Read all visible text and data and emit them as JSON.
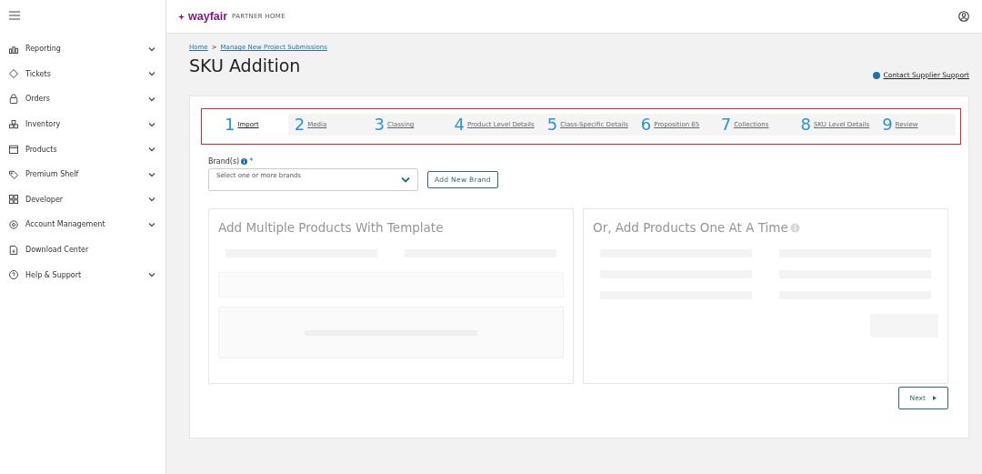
{
  "sidebar": {
    "items": [
      {
        "label": "Reporting",
        "has_submenu": true
      },
      {
        "label": "Tickets",
        "has_submenu": true
      },
      {
        "label": "Orders",
        "has_submenu": true
      },
      {
        "label": "Inventory",
        "has_submenu": true
      },
      {
        "label": "Products",
        "has_submenu": true
      },
      {
        "label": "Premium Shelf",
        "has_submenu": true
      },
      {
        "label": "Developer",
        "has_submenu": true
      },
      {
        "label": "Account Management",
        "has_submenu": true
      },
      {
        "label": "Download Center",
        "has_submenu": false
      },
      {
        "label": "Help & Support",
        "has_submenu": true
      }
    ]
  },
  "header": {
    "logo": "wayfair",
    "logo_suffix": "PARTNER HOME"
  },
  "breadcrumb": [
    "Home",
    "Manage New Project Submissions"
  ],
  "breadcrumb_separator": ">",
  "page_title": "SKU Addition",
  "support_link": "Contact Supplier Support",
  "steps": [
    {
      "number": "1",
      "label": "Import",
      "selected": true
    },
    {
      "number": "2",
      "label": "Media",
      "selected": false
    },
    {
      "number": "3",
      "label": "Classing",
      "selected": false
    },
    {
      "number": "4",
      "label": "Product Level Details",
      "selected": false
    },
    {
      "number": "5",
      "label": "Class-Specific Details",
      "selected": false
    },
    {
      "number": "6",
      "label": "Proposition 65",
      "selected": false
    },
    {
      "number": "7",
      "label": "Collections",
      "selected": false
    },
    {
      "number": "8",
      "label": "SKU Level Details",
      "selected": false
    },
    {
      "number": "9",
      "label": "Review",
      "selected": false
    }
  ],
  "brand_field": {
    "label": "Brand(s)",
    "required_mark": "*",
    "placeholder": "Select one or more brands"
  },
  "add_brand_button": "Add New Brand",
  "cards": [
    {
      "title": "Add Multiple Products With Template",
      "info_icon": false
    },
    {
      "title": "Or, Add Products One At A Time",
      "info_icon": true
    }
  ],
  "next_button": "Next"
}
